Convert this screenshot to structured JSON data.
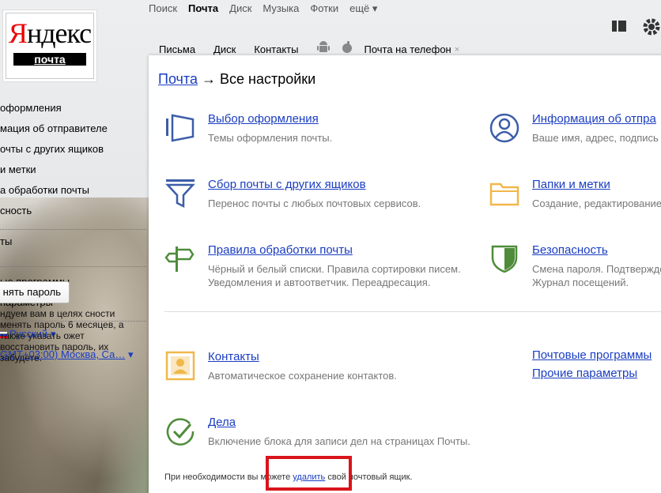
{
  "top_nav": [
    "Поиск",
    "Почта",
    "Диск",
    "Музыка",
    "Фотки",
    "ещё ▾"
  ],
  "logo": {
    "brand_y": "Я",
    "brand_rest": "ндекс",
    "service": "почта"
  },
  "sub_nav": {
    "letters": "Письма",
    "disk": "Диск",
    "contacts": "Контакты",
    "phone": "Почта на телефон",
    "close": "×"
  },
  "left_menu": {
    "items": [
      "оформления",
      "мация об отправителе",
      "очты с других ящиков",
      "и метки",
      "а обработки почты",
      "сность"
    ],
    "item2": "ты",
    "items3": [
      "ые программы",
      "параметры"
    ],
    "lang": "Русский ▾",
    "tz": "GMT+03:00) Москва, Са…",
    "tz_arrow": "▾",
    "change_password": "нять пароль",
    "hint": "ндуем вам в целях сности менять пароль 6 месяцев, а также указать ожет восстановить пароль, их забудете."
  },
  "panel": {
    "crumb_link": "Почта",
    "crumb_rest": " → Все настройки",
    "cards": [
      {
        "title": "Выбор оформления",
        "desc": "Темы оформления почты."
      },
      {
        "title": "Информация об отпра",
        "desc": "Ваше имя, адрес, подпись и"
      },
      {
        "title": "Сбор почты с других ящиков",
        "desc": "Перенос почты с любых почтовых сервисов."
      },
      {
        "title": "Папки и метки",
        "desc": "Создание, редактирование"
      },
      {
        "title": "Правила обработки почты",
        "desc": "Чёрный и белый списки. Правила сортировки писем.",
        "desc2": "Уведомления и автоответчик. Переадресация."
      },
      {
        "title": "Безопасность",
        "desc": "Смена пароля. Подтвержде",
        "desc2": "Журнал посещений."
      },
      {
        "title": "Контакты",
        "desc": "Автоматическое сохранение контактов."
      },
      {
        "title": "Дела",
        "desc": "Включение блока для записи дел на страницах Почты."
      }
    ],
    "links_right": [
      "Почтовые программы",
      "Прочие параметры"
    ],
    "footer_pre": "При необходимости вы можете ",
    "footer_link": "удалить",
    "footer_post": " свой почтовый ящик."
  },
  "colors": {
    "link": "#1a3dc1",
    "icon_blue": "#3c5da8",
    "icon_orange": "#f0b84a",
    "icon_green": "#4e8c3a",
    "highlight": "#d9141b"
  }
}
